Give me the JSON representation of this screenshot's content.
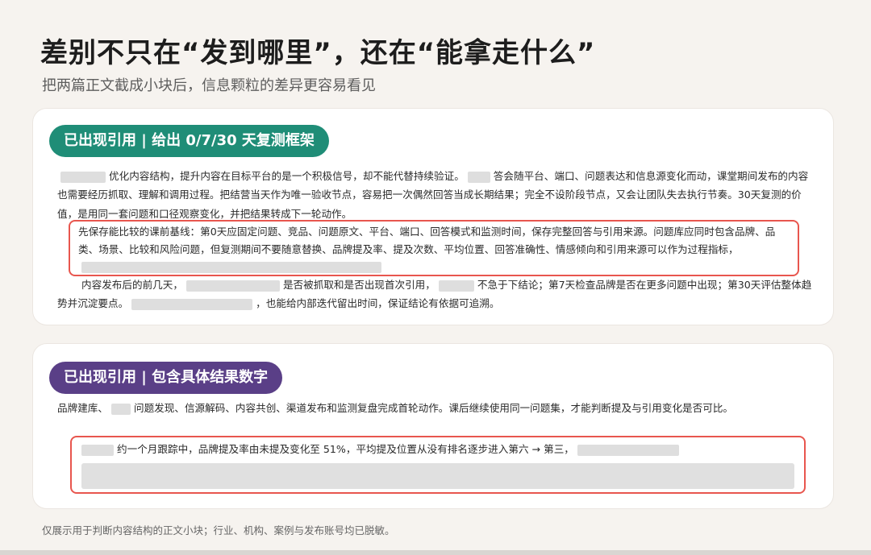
{
  "header": {
    "title": "差别不只在“发到哪里”，还在“能拿走什么”",
    "subtitle": "把两篇正文截成小块后，信息颗粒的差异更容易看见"
  },
  "card1": {
    "badge": "已出现引用 | 给出 0/7/30 天复测框架",
    "para1_a": "优化内容结构，提升内容在目标平台的是一个积极信号，却不能代替持续验证。",
    "para1_b": "答会随平台、端口、问题表达和信息源变化而动，课堂期间发布的内容也需要经历抓取、理解和调用过程。把结营当天作为唯一验收节点，容易把一次偶然回答当成长期结果；完全不设阶段节点，又会让团队失去执行节奏。30天复测的价值，是用同一套问题和口径观察变化，并把结果转成下一轮动作。",
    "callout": "先保存能比较的课前基线：第0天应固定问题、竞品、问题原文、平台、端口、回答模式和监测时间，保存完整回答与引用来源。问题库应同时包含品牌、品类、场景、比较和风险问题，但复测期间不要随意替换、品牌提及率、提及次数、平均位置、回答准确性、情感倾向和引用来源可以作为过程指标，",
    "para3_a": "内容发布后的前几天，",
    "para3_b": "是否被抓取和是否出现首次引用，",
    "para3_c": "不急于下结论；第7天检查品牌是否在更多问题中出现；第30天评估整体趋势并沉淀要点。",
    "para3_d": "，也能给内部迭代留出时间，保证结论有依据可追溯。"
  },
  "card2": {
    "badge": "已出现引用 | 包含具体结果数字",
    "para1_a": "品牌建库、",
    "para1_b": "问题发现、信源解码、内容共创、渠道发布和监测复盘完成首轮动作。课后继续使用同一问题集，才能判断提及与引用变化是否可比。",
    "callout": "约一个月跟踪中，品牌提及率由未提及变化至 51%，平均提及位置从没有排名逐步进入第六 → 第三，"
  },
  "footnote": "仅展示用于判断内容结构的正文小块；行业、机构、案例与发布账号均已脱敏。"
}
